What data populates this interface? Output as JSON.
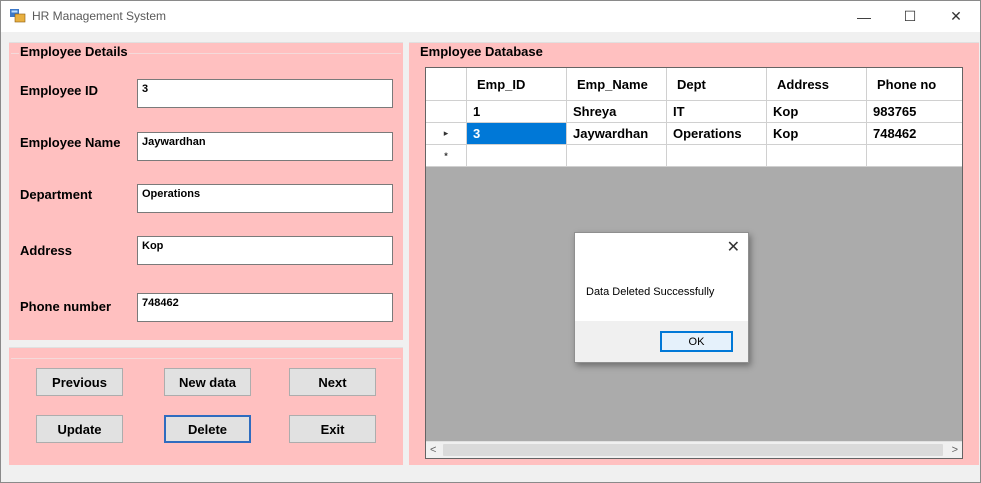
{
  "window": {
    "title": "HR Management System",
    "minimize": "—",
    "maximize": "☐",
    "close": "✕"
  },
  "details": {
    "title": "Employee Details",
    "fields": [
      {
        "label": "Employee ID",
        "value": "3"
      },
      {
        "label": "Employee Name",
        "value": "Jaywardhan"
      },
      {
        "label": "Department",
        "value": "Operations"
      },
      {
        "label": "Address",
        "value": "Kop"
      },
      {
        "label": "Phone number",
        "value": "748462"
      }
    ]
  },
  "buttons": {
    "previous": "Previous",
    "new_data": "New data",
    "next": "Next",
    "update": "Update",
    "delete": "Delete",
    "exit": "Exit"
  },
  "database": {
    "title": "Employee Database",
    "columns": [
      "Emp_ID",
      "Emp_Name",
      "Dept",
      "Address",
      "Phone no"
    ],
    "rows": [
      [
        "1",
        "Shreya",
        "IT",
        "Kop",
        "983765"
      ],
      [
        "3",
        "Jaywardhan",
        "Operations",
        "Kop",
        "748462"
      ]
    ],
    "current_row_marker": "▸",
    "new_row_marker": "*"
  },
  "scrollbar": {
    "left_arrow": "<",
    "right_arrow": ">"
  },
  "dialog": {
    "message": "Data Deleted Successfully",
    "ok": "OK",
    "close": "✕"
  },
  "colors": {
    "panel": "#ffc0c0",
    "selection": "#0078d7",
    "grid_bg": "#ababab"
  }
}
